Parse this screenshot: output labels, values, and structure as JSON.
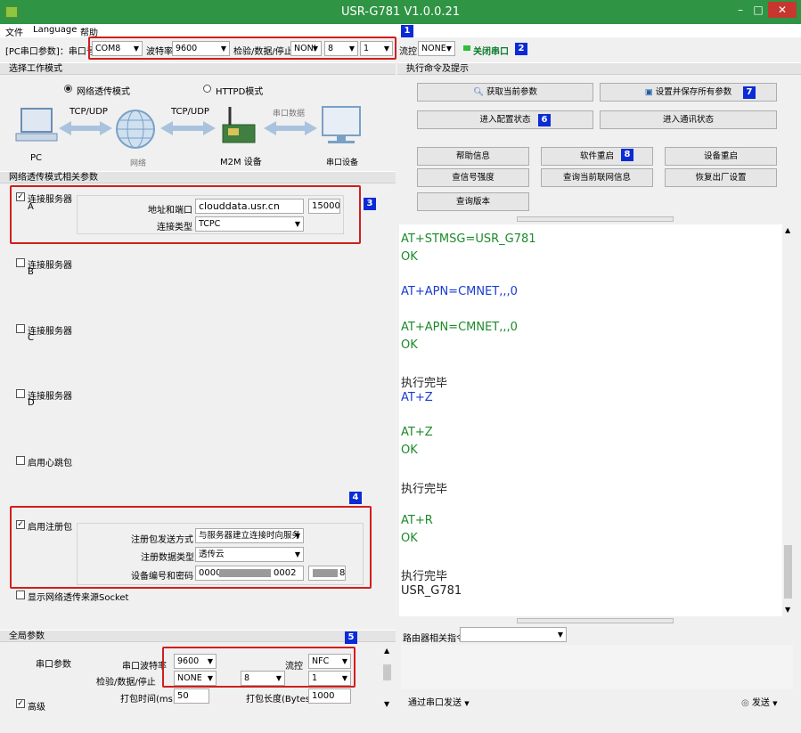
{
  "window": {
    "title": "USR-G781 V1.0.0.21",
    "minimize": "–",
    "maximize": "□",
    "close": "✕"
  },
  "menu": [
    "文件",
    "Language",
    "帮助"
  ],
  "toolbar": {
    "pc_label": "[PC串口参数]：串口号",
    "port": "COM8",
    "baud_label": "波特率",
    "baud": "9600",
    "check_label": "检验/数据/停止",
    "parity": "NONI",
    "data_bits": "8",
    "stop_bits": "1",
    "flow_label": "流控",
    "flow": "NONE",
    "close_port": "关闭串口"
  },
  "badges": [
    "1",
    "2",
    "3",
    "4",
    "5",
    "6",
    "7",
    "8"
  ],
  "work_mode": {
    "header": "选择工作模式",
    "opt1": "网络透传模式",
    "opt2": "HTTPD模式",
    "pc": "PC",
    "tcp1": "TCP/UDP",
    "tcp2": "TCP/UDP",
    "net": "网络",
    "m2m": "M2M 设备",
    "serial_data": "串口数据",
    "serial_dev": "串口设备"
  },
  "net_params": {
    "header": "网络透传模式相关参数",
    "serverA": "连接服务器",
    "serverA_sub": "A",
    "addr_label": "地址和端口",
    "addr": "clouddata.usr.cn",
    "port": "15000",
    "type_label": "连接类型",
    "type": "TCPC",
    "serverB": "连接服务器",
    "serverB_sub": "B",
    "serverC": "连接服务器",
    "serverC_sub": "C",
    "serverD": "连接服务器",
    "serverD_sub": "D",
    "heartbeat": "启用心跳包",
    "register": "启用注册包",
    "reg_send_label": "注册包发送方式",
    "reg_send": "与服务器建立连接时向服务",
    "reg_type_label": "注册数据类型",
    "reg_type": "透传云",
    "dev_label": "设备编号和密码",
    "dev_id_a": "0000",
    "dev_id_b": "0002",
    "dev_pwd": "8",
    "show_src": "显示网络透传来源Socket"
  },
  "global": {
    "header": "全局参数",
    "serial_label": "串口参数",
    "baud_label": "串口波特率",
    "baud": "9600",
    "flow_label": "流控",
    "flow": "NFC",
    "check_label": "检验/数据/停止",
    "parity": "NONE",
    "data_bits": "8",
    "stop_bits": "1",
    "pack_time_label": "打包时间(ms)",
    "pack_time": "50",
    "pack_len_label": "打包长度(Bytes)",
    "pack_len": "1000",
    "advanced": "高级"
  },
  "commands": {
    "header": "执行命令及提示",
    "get_params": "获取当前参数",
    "save_all": "设置并保存所有参数",
    "enter_config": "进入配置状态",
    "enter_comm": "进入通讯状态",
    "help": "帮助信息",
    "restart": "软件重启",
    "device_restart": "设备重启",
    "signal": "查信号强度",
    "network_info": "查询当前联网信息",
    "factory": "恢复出厂设置",
    "version": "查询版本"
  },
  "terminal": [
    {
      "text": "AT+STMSG=USR_G781",
      "color": "green"
    },
    {
      "text": "OK",
      "color": "green"
    },
    {
      "text": "AT+APN=CMNET,,,0",
      "color": "blue"
    },
    {
      "text": "AT+APN=CMNET,,,0",
      "color": "green"
    },
    {
      "text": "OK",
      "color": "green"
    },
    {
      "text": "执行完毕",
      "color": "black"
    },
    {
      "text": "AT+Z",
      "color": "blue"
    },
    {
      "text": "AT+Z",
      "color": "green"
    },
    {
      "text": "OK",
      "color": "green"
    },
    {
      "text": "执行完毕",
      "color": "black"
    },
    {
      "text": "AT+R",
      "color": "green"
    },
    {
      "text": "OK",
      "color": "green"
    },
    {
      "text": "执行完毕",
      "color": "black"
    },
    {
      "text": "USR_G781",
      "color": "black"
    }
  ],
  "router": {
    "label": "路由器相关指令",
    "send_via": "通过串口发送",
    "send": "发送"
  }
}
